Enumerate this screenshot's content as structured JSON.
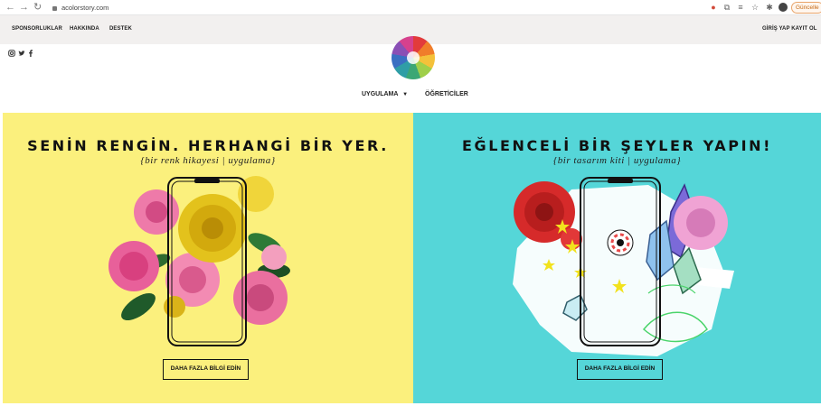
{
  "browser": {
    "url": "acolorstory.com",
    "update_label": "Güncelle"
  },
  "header": {
    "top_links": [
      "SPONSORLUKLAR",
      "HAKKINDA",
      "DESTEK"
    ],
    "account_label": "GİRİŞ YAP KAYIT OL",
    "main_nav": {
      "app_label": "UYGULAMA",
      "app_caret": "▼",
      "teachers_label": "ÖĞRETİCİLER"
    },
    "social_icons": [
      "instagram-icon",
      "twitter-icon",
      "facebook-icon"
    ]
  },
  "panels": {
    "left": {
      "title": "SENİN RENGİN. HERHANGİ BİR YER.",
      "subtitle": "{bir renk hikayesi | uygulama}",
      "button_label": "DAHA FAZLA BİLGİ EDİN",
      "background": "#fbf07d"
    },
    "right": {
      "title": "EĞLENCELİ BİR ŞEYLER YAPIN!",
      "subtitle": "{bir tasarım kiti | uygulama}",
      "button_label": "DAHA FAZLA BİLGİ EDİN",
      "background": "#55d6d8"
    }
  }
}
